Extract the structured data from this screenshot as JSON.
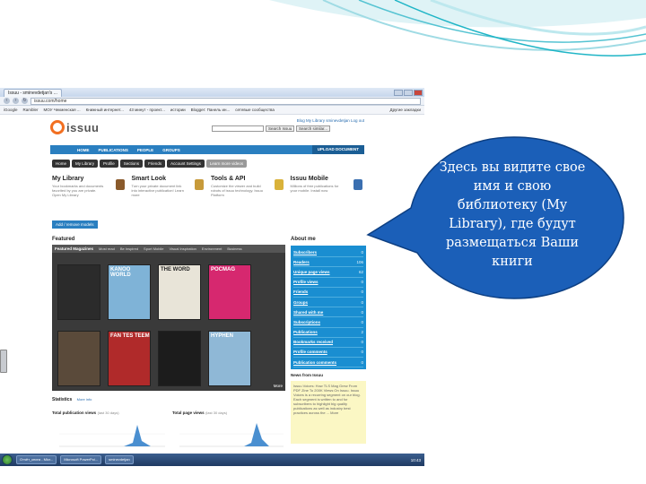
{
  "colors": {
    "accent_teal": "#1fb5c6",
    "issuu_blue": "#2a7fc0",
    "callout_blue": "#1b5fb8",
    "issuu_orange": "#f26f21"
  },
  "browser": {
    "tab_title": "Issuu - sminevdetjan's ...",
    "url": "issuu.com/home",
    "bookmarks": [
      "iGoogle",
      "Rambler",
      "МОУ Чекменская ...",
      "Книжный интернет...",
      "43 минут - проект...",
      "истории",
      "Blogger: Панель ин...",
      "сетевые сообщества",
      "Другие закладки"
    ]
  },
  "issuu": {
    "logo": "issuu",
    "search_button": "Search Issuu",
    "search_similar": "Search similar...",
    "top_links": "Blog   My Library   sminevdetjan   Log out",
    "nav": [
      "HOME",
      "PUBLICATIONS",
      "PEOPLE",
      "GROUPS"
    ],
    "upload": "UPLOAD DOCUMENT",
    "subnav": [
      "Home",
      "My Library",
      "Profile",
      "Sections",
      "Friends",
      "Account Settings",
      "Learn more videos"
    ],
    "panels": [
      {
        "title": "My Library",
        "text": "Your bookmarks and documents favorited by you are private. Open My Library"
      },
      {
        "title": "Smart Look",
        "text": "Turn your private document link into interactive publication! Learn more"
      },
      {
        "title": "Tools & API",
        "text": "Customize the viewer and build robots of issuu technology. Issuu Platform"
      },
      {
        "title": "Issuu Mobile",
        "text": "Millions of free publications for your mobile. Install now"
      }
    ],
    "add_button": "Add / remove models",
    "featured_heading": "Featured",
    "featured_tabs": [
      "Featured Magazines",
      "Most read",
      "Be Inspired",
      "Sport Mobile",
      "Visual Inspiration",
      "Environment",
      "Business"
    ],
    "covers": [
      {
        "title": "",
        "color": "#2b2b2b"
      },
      {
        "title": "KANOO WORLD",
        "color": "#7fb3d7"
      },
      {
        "title": "THE WORD",
        "color": "#e8e4d8"
      },
      {
        "title": "POCMAG",
        "color": "#d6286f"
      },
      {
        "title": "",
        "color": "#5a4a3a"
      },
      {
        "title": "FAN TES TEEM",
        "color": "#b02a2a"
      },
      {
        "title": "",
        "color": "#1c1c1c"
      },
      {
        "title": "HYPHEN",
        "color": "#8fb8d6"
      }
    ],
    "more": "More",
    "about_heading": "About me",
    "about": [
      {
        "label": "Subscribers",
        "value": "0"
      },
      {
        "label": "Readers",
        "value": "106"
      },
      {
        "label": "Unique page views",
        "value": "62"
      },
      {
        "label": "Profile views",
        "value": "0"
      },
      {
        "label": "Friends",
        "value": "0"
      },
      {
        "label": "Groups",
        "value": "0"
      },
      {
        "label": "Shared with me",
        "value": "0"
      },
      {
        "label": "Subscriptions",
        "value": "0"
      },
      {
        "label": "Publications",
        "value": "2"
      },
      {
        "label": "Bookmarks received",
        "value": "0"
      },
      {
        "label": "Profile comments",
        "value": "0"
      },
      {
        "label": "Publication comments",
        "value": "0"
      }
    ],
    "news_heading": "News from Issuu",
    "news_text": "Issuu Voices: How TLS Mag Grew From PDF Zine To 200K Views On Issuu. Issuu Voices is a recurring segment on our blog. Each segment is written to and for subscribers to highlight big quality publications as well as industry best practices across the ... More",
    "stats_heading": "Statistics",
    "stats_more": "More info",
    "chart_titles": [
      "Total publication views",
      "Total page views"
    ],
    "chart_note": "(last 30 days)"
  },
  "taskbar": {
    "tasks": [
      "Отчёт_книга - Micr...",
      "Microsoft PowerPoi...",
      "sminevdetjan"
    ],
    "clock": "10:43"
  },
  "callout": {
    "text": "Здесь вы видите свое имя и свою библиотеку (My Library), где будут размещаться Ваши книги"
  }
}
